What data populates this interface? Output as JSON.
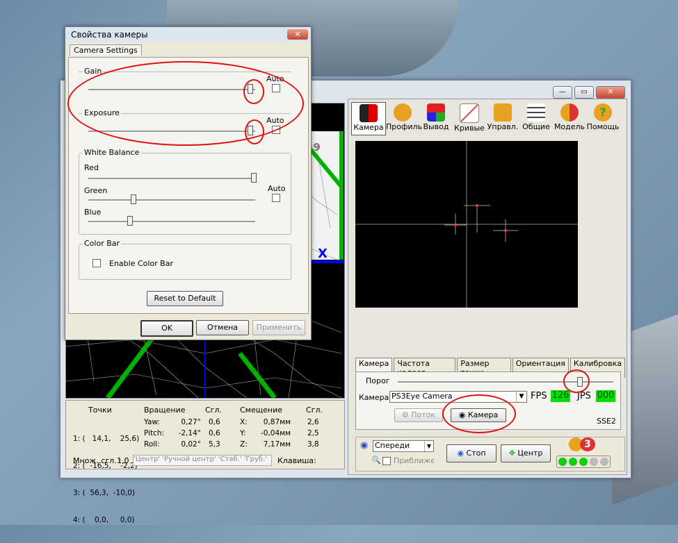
{
  "dialog": {
    "title": "Свойства камеры",
    "close_glyph": "✕",
    "tab": "Camera Settings",
    "gain_label": "Gain",
    "exposure_label": "Exposure",
    "auto_label": "Auto",
    "white_balance_label": "White Balance",
    "red_label": "Red",
    "green_label": "Green",
    "blue_label": "Blue",
    "color_bar_label": "Color Bar",
    "enable_color_bar": "Enable Color Bar",
    "reset_button": "Reset to Default",
    "ok_button": "OK",
    "cancel_button": "Отмена",
    "apply_button": "Применить",
    "sliders": {
      "gain": 0.98,
      "exposure": 0.98,
      "red": 1.0,
      "green": 0.26,
      "blue": 0.24
    }
  },
  "main": {
    "toolbar": [
      "Камера",
      "Профиль",
      "Вывод",
      "Кривые",
      "Управл.",
      "Общие",
      "Модель",
      "Помощь"
    ],
    "tabs": [
      "Камера",
      "Частота кадров",
      "Размер точки",
      "Ориентация",
      "Калибровка"
    ],
    "threshold_label": "Порог",
    "camera_label": "Камера",
    "camera_select": "PS3Eye Camera",
    "fps_label": "FPS",
    "fps_value": "126",
    "jps_label": "JPS",
    "jps_value": "000",
    "stream_button": "Поток",
    "camera_button": "Камера",
    "sse_label": "SSE2",
    "view_select": "Спереди",
    "zoom_label": "Приближен",
    "stop_button": "Стоп",
    "center_button": "Центр",
    "overlay_number": "49",
    "overlay_x": "X",
    "logo_number": "3",
    "threshold_level": 0.85,
    "info": {
      "points_header": "Точки",
      "rotation_header": "Вращение",
      "smooth_header": "Сгл.",
      "offset_header": "Смещение",
      "smooth_header2": "Сгл.",
      "points": [
        "1: (   14,1,    25,6)",
        "2: (  -16,5,    -2,2)",
        "3: (  56,3,  -10,0)",
        "4: (    0,0,     0,0)"
      ],
      "rot_labels": [
        "Yaw:",
        "Pitch:",
        "Roll:"
      ],
      "rot_values": [
        "0,27°",
        "-2,14°",
        "0,02°"
      ],
      "rot_smooth": [
        "0,6",
        "0,6",
        "5,3"
      ],
      "off_labels": [
        "X:",
        "Y:",
        "Z:"
      ],
      "off_values": [
        "0,87мм",
        "-0,04мм",
        "7,17мм"
      ],
      "off_smooth": [
        "2,6",
        "2,5",
        "3,8"
      ],
      "mult_label": "Множ. сгл. :",
      "mult_value": "1,0",
      "hotkeys": "'Центр' 'Ручной центр' 'Стаб.' 'Груб.'",
      "hotkey_label": "Клавиша:"
    }
  }
}
